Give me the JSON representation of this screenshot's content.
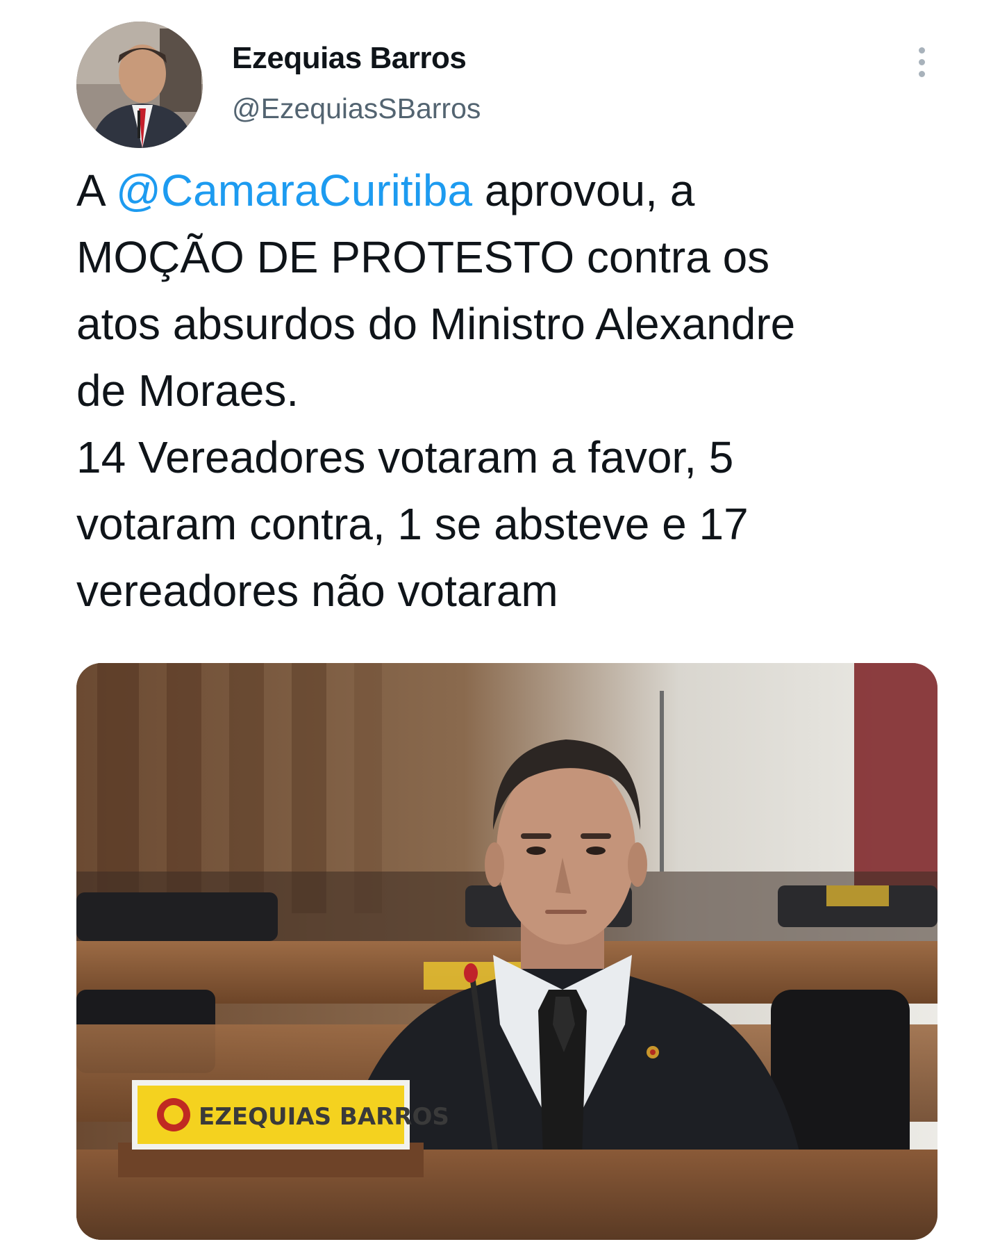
{
  "author": {
    "display_name": "Ezequias Barros",
    "handle": "@EzequiasSBarros",
    "avatar_icon": "profile-photo"
  },
  "menu": {
    "icon": "more-vertical-icon"
  },
  "tweet": {
    "line1_prefix": "A ",
    "mention": "@CamaraCuritiba",
    "line1_suffix": " aprovou, a",
    "line2": "MOÇÃO DE PROTESTO contra os",
    "line3": "atos absurdos do Ministro Alexandre",
    "line4": "de Moraes.",
    "line5": "14 Vereadores votaram a favor, 5",
    "line6": "votaram contra, 1 se absteve e 17",
    "line7": "vereadores não votaram"
  },
  "media": {
    "nameplate_text": "EZEQUIAS BARROS"
  },
  "colors": {
    "mention": "#1d9bf0",
    "text": "#0f1419",
    "secondary": "#536471"
  }
}
